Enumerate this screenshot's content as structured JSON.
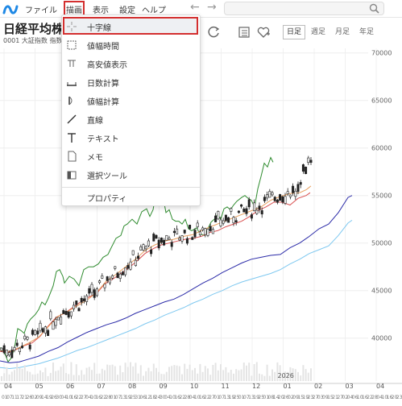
{
  "menu": {
    "items": [
      "ファイル",
      "描画",
      "表示",
      "設定",
      "ヘルプ"
    ],
    "active": "描画"
  },
  "stock": {
    "title": "日経平均株",
    "subtitle": "0001 大証指数 指数"
  },
  "periods": [
    {
      "label": "日足",
      "active": true
    },
    {
      "label": "週足",
      "active": false
    },
    {
      "label": "月足",
      "active": false
    },
    {
      "label": "年足",
      "active": false
    }
  ],
  "dropdown": {
    "items": [
      {
        "label": "十字線",
        "icon": "crosshair-icon",
        "highlighted": true
      },
      {
        "label": "値幅時間",
        "icon": "range-time-icon"
      },
      {
        "label": "高安値表示",
        "icon": "high-low-icon"
      },
      {
        "label": "日数計算",
        "icon": "day-count-icon"
      },
      {
        "label": "値幅計算",
        "icon": "range-calc-icon"
      },
      {
        "label": "直線",
        "icon": "line-icon"
      },
      {
        "label": "テキスト",
        "icon": "text-icon"
      },
      {
        "label": "メモ",
        "icon": "memo-icon"
      },
      {
        "label": "選択ツール",
        "icon": "select-tool-icon"
      }
    ],
    "footer": {
      "label": "プロパティ"
    }
  },
  "chart_data": {
    "type": "candlestick",
    "y_ticks": [
      "70000",
      "65000",
      "60000",
      "55000",
      "50000",
      "45000",
      "40000"
    ],
    "ylim": [
      36500,
      71500
    ],
    "month_labels": [
      "04",
      "05",
      "06",
      "07",
      "08",
      "09",
      "10",
      "11",
      "12",
      "2026\n01",
      "02",
      "03",
      "04"
    ],
    "day_labels": [
      "01",
      "07",
      "11",
      "17",
      "21",
      "26",
      "02",
      "09",
      "14",
      "19",
      "26",
      "30",
      "04",
      "10",
      "16",
      "22",
      "27",
      "04",
      "10",
      "16",
      "22",
      "28",
      "01",
      "07",
      "13",
      "19",
      "25",
      "31",
      "06",
      "12",
      "18",
      "24",
      "30",
      "04",
      "10",
      "16",
      "22",
      "28",
      "04",
      "10",
      "16",
      "22",
      "27",
      "01",
      "07",
      "13",
      "19",
      "25",
      "01",
      "07",
      "13",
      "19",
      "25",
      "01",
      "08",
      "14",
      "20",
      "26",
      "02",
      "09",
      "15",
      "19",
      "23",
      "27",
      "03",
      "09",
      "15",
      "21",
      "27",
      "02",
      "04",
      "06",
      "10",
      "16",
      "22",
      "28",
      "04",
      "10",
      "16",
      "20",
      "23"
    ],
    "series": [
      {
        "name": "",
        "color": "#2e8b2e",
        "values": [
          [
            0,
            39000
          ],
          [
            5,
            38600
          ],
          [
            10,
            37500
          ],
          [
            14,
            37900
          ],
          [
            18,
            39000
          ],
          [
            22,
            41000
          ],
          [
            26,
            40800
          ],
          [
            30,
            40500
          ],
          [
            34,
            41500
          ],
          [
            38,
            42000
          ],
          [
            44,
            42500
          ],
          [
            48,
            43000
          ],
          [
            52,
            43800
          ],
          [
            56,
            43500
          ],
          [
            60,
            44200
          ],
          [
            66,
            45500
          ],
          [
            70,
            47000
          ],
          [
            74,
            47200
          ],
          [
            78,
            46500
          ],
          [
            80,
            45800
          ],
          [
            86,
            46500
          ],
          [
            92,
            46200
          ],
          [
            98,
            45500
          ],
          [
            104,
            47200
          ],
          [
            110,
            47500
          ],
          [
            116,
            47500
          ],
          [
            122,
            47800
          ],
          [
            128,
            48500
          ],
          [
            134,
            48800
          ],
          [
            138,
            49500
          ],
          [
            144,
            50500
          ],
          [
            150,
            50800
          ],
          [
            154,
            51800
          ],
          [
            158,
            52000
          ],
          [
            164,
            52500
          ],
          [
            170,
            52000
          ],
          [
            176,
            53300
          ],
          [
            182,
            53600
          ],
          [
            186,
            52800
          ],
          [
            190,
            53500
          ],
          [
            192,
            54500
          ],
          [
            198,
            54800
          ],
          [
            202,
            55000
          ],
          [
            206,
            53200
          ],
          [
            210,
            53500
          ],
          [
            214,
            52500
          ],
          [
            218,
            52300
          ],
          [
            222,
            52300
          ],
          [
            226,
            52000
          ],
          [
            230,
            52500
          ],
          [
            234,
            51500
          ],
          [
            238,
            51300
          ],
          [
            244,
            51600
          ],
          [
            248,
            51000
          ],
          [
            254,
            50800
          ],
          [
            258,
            51500
          ],
          [
            262,
            52200
          ],
          [
            266,
            52500
          ],
          [
            270,
            53000
          ],
          [
            274,
            52500
          ],
          [
            278,
            53600
          ],
          [
            282,
            53800
          ],
          [
            286,
            53500
          ],
          [
            290,
            54000
          ],
          [
            294,
            54400
          ],
          [
            300,
            54800
          ],
          [
            304,
            55000
          ],
          [
            308,
            54700
          ],
          [
            312,
            54500
          ],
          [
            316,
            53800
          ],
          [
            320,
            55700
          ],
          [
            324,
            57000
          ],
          [
            328,
            58400
          ],
          [
            332,
            58000
          ],
          [
            336,
            59000
          ],
          [
            339,
            58500
          ]
        ]
      },
      {
        "name": "",
        "color": "#d95050",
        "values": [
          [
            0,
            38600
          ],
          [
            10,
            38500
          ],
          [
            20,
            38800
          ],
          [
            30,
            39200
          ],
          [
            40,
            39500
          ],
          [
            50,
            40200
          ],
          [
            60,
            41300
          ],
          [
            70,
            42200
          ],
          [
            80,
            42600
          ],
          [
            90,
            43200
          ],
          [
            100,
            43800
          ],
          [
            110,
            44300
          ],
          [
            120,
            44700
          ],
          [
            130,
            45700
          ],
          [
            140,
            46200
          ],
          [
            150,
            46800
          ],
          [
            160,
            47400
          ],
          [
            170,
            48100
          ],
          [
            180,
            48900
          ],
          [
            190,
            49400
          ],
          [
            200,
            49800
          ],
          [
            210,
            50000
          ],
          [
            220,
            50200
          ],
          [
            230,
            50400
          ],
          [
            240,
            50500
          ],
          [
            250,
            50700
          ],
          [
            260,
            51100
          ],
          [
            270,
            51300
          ],
          [
            280,
            51700
          ],
          [
            290,
            52000
          ],
          [
            300,
            52300
          ],
          [
            310,
            52800
          ],
          [
            320,
            53400
          ],
          [
            330,
            53800
          ],
          [
            340,
            54300
          ],
          [
            350,
            54300
          ],
          [
            360,
            54000
          ],
          [
            370,
            54700
          ],
          [
            380,
            55000
          ],
          [
            385,
            55300
          ]
        ]
      },
      {
        "name": "",
        "color": "#e8a060",
        "values": [
          [
            0,
            38700
          ],
          [
            12,
            38600
          ],
          [
            24,
            39000
          ],
          [
            36,
            39500
          ],
          [
            48,
            40100
          ],
          [
            60,
            41200
          ],
          [
            72,
            42300
          ],
          [
            84,
            42800
          ],
          [
            96,
            43400
          ],
          [
            108,
            44000
          ],
          [
            120,
            44800
          ],
          [
            132,
            46000
          ],
          [
            144,
            46700
          ],
          [
            156,
            47500
          ],
          [
            168,
            48300
          ],
          [
            180,
            49200
          ],
          [
            192,
            49800
          ],
          [
            204,
            50200
          ],
          [
            216,
            50400
          ],
          [
            228,
            50700
          ],
          [
            240,
            50900
          ],
          [
            252,
            51400
          ],
          [
            264,
            51800
          ],
          [
            276,
            52200
          ],
          [
            288,
            52600
          ],
          [
            300,
            53000
          ],
          [
            312,
            53400
          ],
          [
            324,
            53800
          ],
          [
            336,
            54500
          ],
          [
            348,
            54900
          ],
          [
            360,
            55200
          ],
          [
            372,
            55300
          ],
          [
            380,
            55600
          ],
          [
            386,
            56000
          ]
        ]
      },
      {
        "name": "",
        "color": "#2b2ba8",
        "values": [
          [
            0,
            37600
          ],
          [
            12,
            37400
          ],
          [
            24,
            37500
          ],
          [
            36,
            37800
          ],
          [
            48,
            38100
          ],
          [
            60,
            38600
          ],
          [
            72,
            39000
          ],
          [
            84,
            39600
          ],
          [
            96,
            40100
          ],
          [
            108,
            40600
          ],
          [
            120,
            41000
          ],
          [
            132,
            41400
          ],
          [
            144,
            41700
          ],
          [
            156,
            42100
          ],
          [
            168,
            42600
          ],
          [
            180,
            43000
          ],
          [
            192,
            43400
          ],
          [
            204,
            43800
          ],
          [
            216,
            44100
          ],
          [
            228,
            44600
          ],
          [
            240,
            45200
          ],
          [
            252,
            45800
          ],
          [
            264,
            46300
          ],
          [
            276,
            46900
          ],
          [
            288,
            47400
          ],
          [
            300,
            47900
          ],
          [
            312,
            48300
          ],
          [
            324,
            48500
          ],
          [
            336,
            48700
          ],
          [
            348,
            48800
          ],
          [
            360,
            49500
          ],
          [
            372,
            50000
          ],
          [
            384,
            50700
          ],
          [
            396,
            51500
          ],
          [
            408,
            52000
          ],
          [
            420,
            53200
          ],
          [
            432,
            54800
          ],
          [
            437,
            55000
          ]
        ]
      },
      {
        "name": "",
        "color": "#7ec8f0",
        "values": [
          [
            0,
            36900
          ],
          [
            12,
            36800
          ],
          [
            24,
            36900
          ],
          [
            36,
            37100
          ],
          [
            48,
            37300
          ],
          [
            60,
            37600
          ],
          [
            72,
            37900
          ],
          [
            84,
            38300
          ],
          [
            96,
            38700
          ],
          [
            108,
            39000
          ],
          [
            120,
            39400
          ],
          [
            132,
            39800
          ],
          [
            144,
            40200
          ],
          [
            156,
            40600
          ],
          [
            168,
            41000
          ],
          [
            180,
            41500
          ],
          [
            192,
            41900
          ],
          [
            204,
            42400
          ],
          [
            216,
            42800
          ],
          [
            228,
            43200
          ],
          [
            240,
            43700
          ],
          [
            252,
            44100
          ],
          [
            264,
            44600
          ],
          [
            276,
            45000
          ],
          [
            288,
            45500
          ],
          [
            300,
            45900
          ],
          [
            312,
            46200
          ],
          [
            324,
            46500
          ],
          [
            336,
            46800
          ],
          [
            348,
            47200
          ],
          [
            360,
            47800
          ],
          [
            372,
            48300
          ],
          [
            384,
            48900
          ],
          [
            396,
            49300
          ],
          [
            408,
            49700
          ],
          [
            420,
            50800
          ],
          [
            432,
            52100
          ],
          [
            437,
            52400
          ]
        ]
      }
    ]
  }
}
